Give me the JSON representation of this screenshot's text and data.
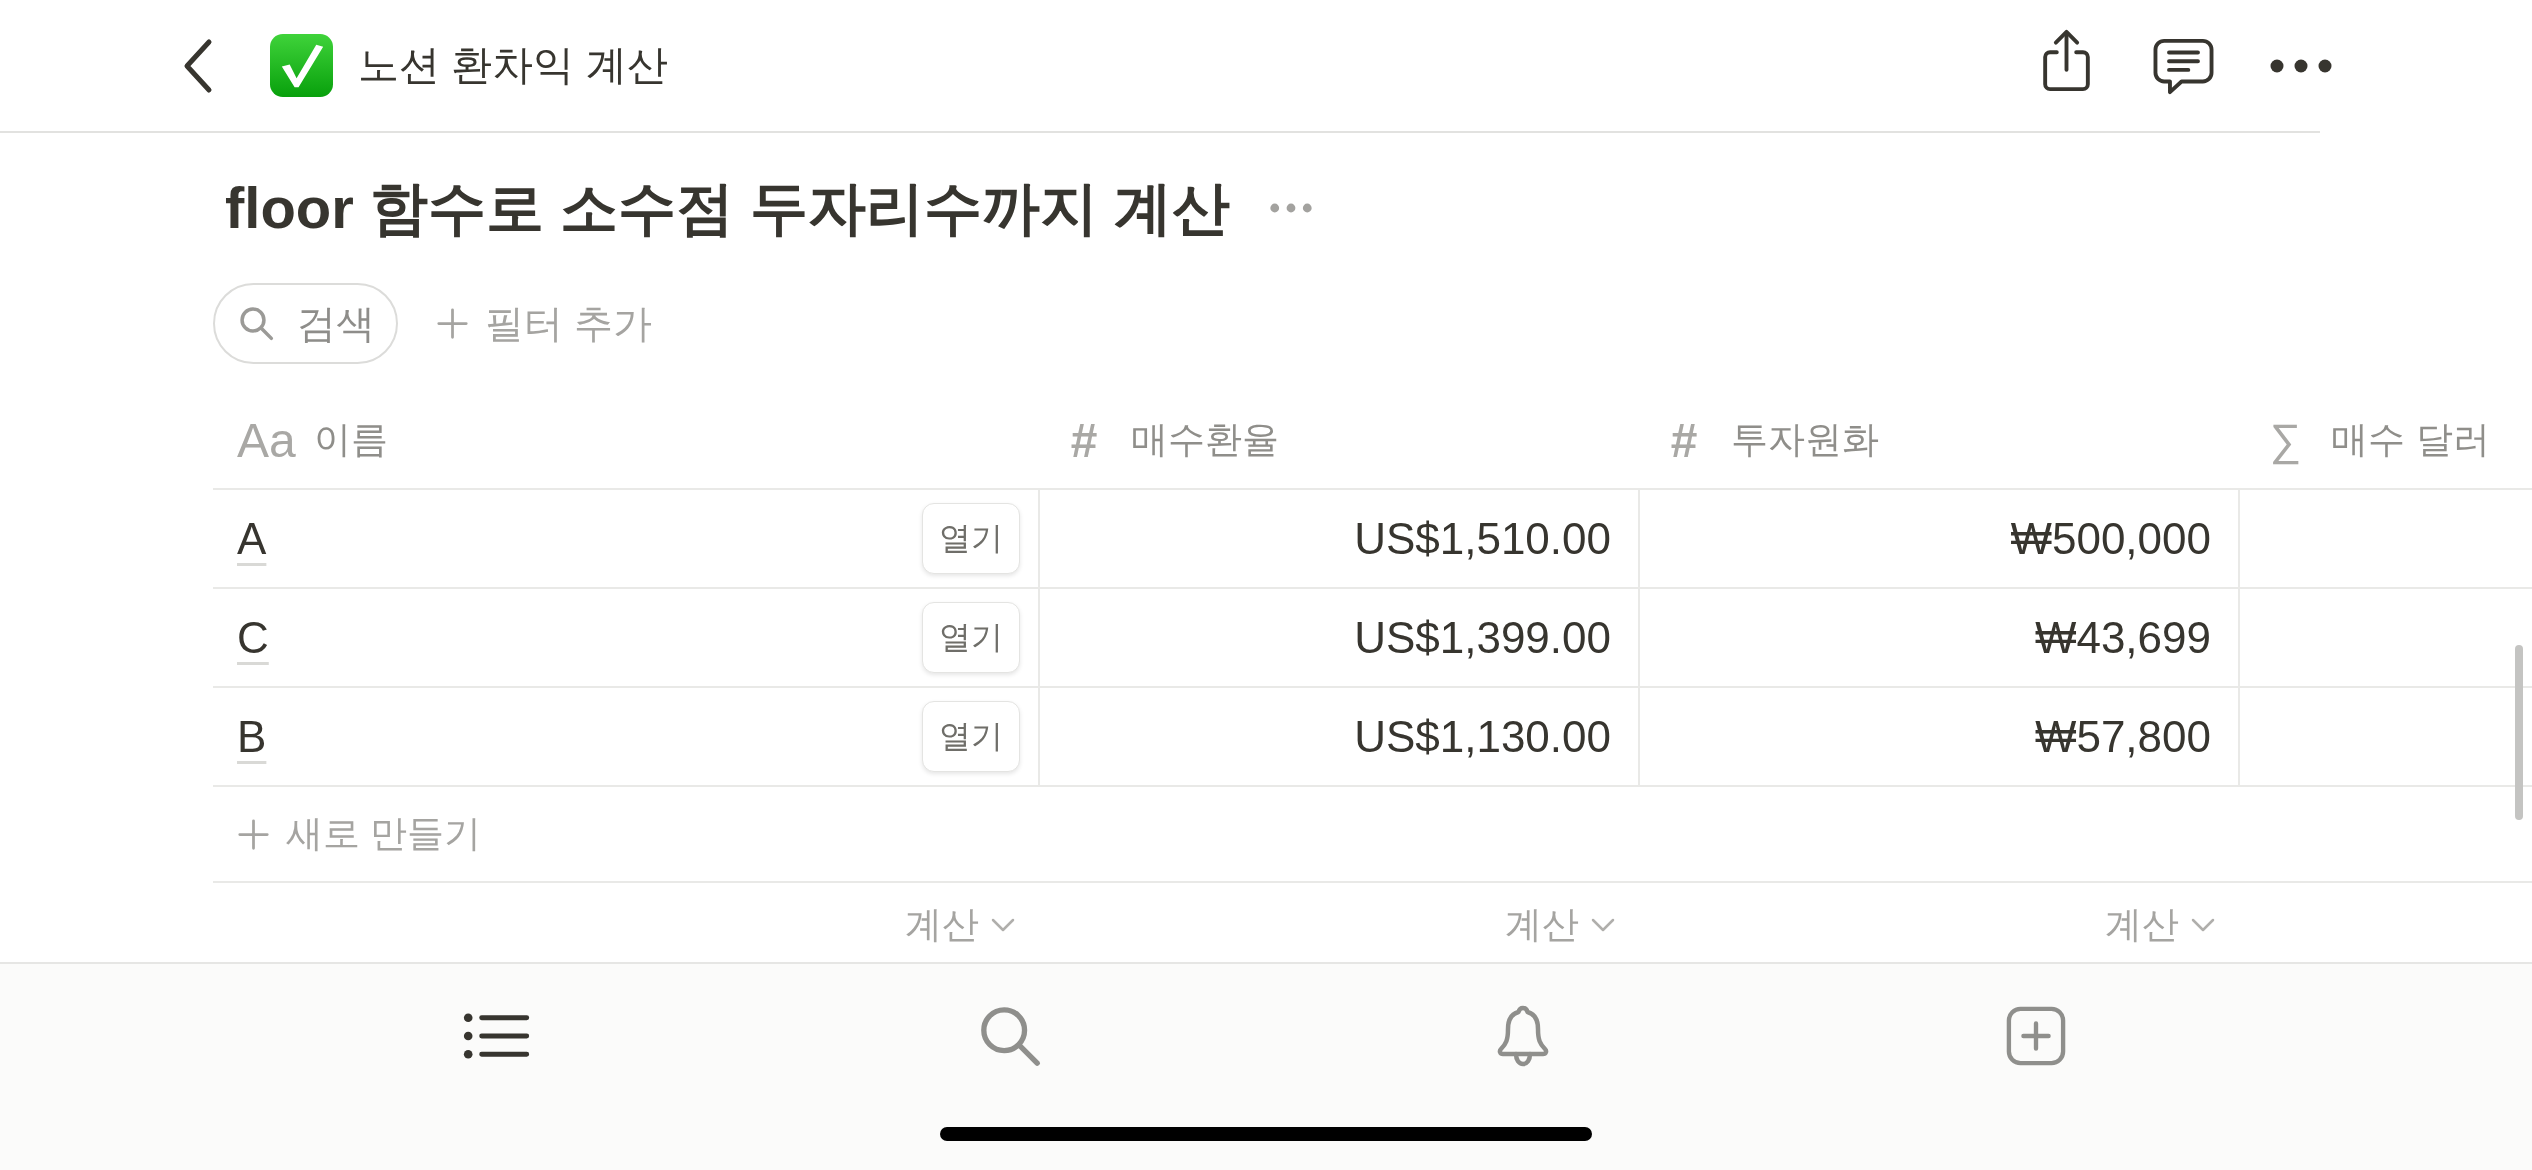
{
  "top_bar": {
    "title": "노션 환차익 계산"
  },
  "page": {
    "title": "floor 함수로 소수점 두자리수까지 계산"
  },
  "toolbar": {
    "search": {
      "placeholder": "검색"
    },
    "add_filter": "필터 추가"
  },
  "table": {
    "columns": [
      {
        "kind": "title",
        "icon": "Aa",
        "label": "이름"
      },
      {
        "kind": "number",
        "icon": "#",
        "label": "매수환율"
      },
      {
        "kind": "number",
        "icon": "#",
        "label": "투자원화"
      },
      {
        "kind": "formula",
        "icon": "∑",
        "label": "매수 달러"
      }
    ],
    "rows": [
      {
        "name": "A",
        "open_button": "열기",
        "cells": [
          "US$1,510.00",
          "₩500,000"
        ]
      },
      {
        "name": "C",
        "open_button": "열기",
        "cells": [
          "US$1,399.00",
          "₩43,699"
        ]
      },
      {
        "name": "B",
        "open_button": "열기",
        "cells": [
          "US$1,130.00",
          "₩57,800"
        ]
      }
    ],
    "new_row": "새로 만들기",
    "calculations": [
      "계산",
      "계산",
      "계산"
    ]
  },
  "bottom_nav": [
    {
      "kind": "list",
      "selected": true
    },
    {
      "kind": "search",
      "selected": false
    },
    {
      "kind": "bell",
      "selected": false
    },
    {
      "kind": "add",
      "selected": false
    }
  ]
}
